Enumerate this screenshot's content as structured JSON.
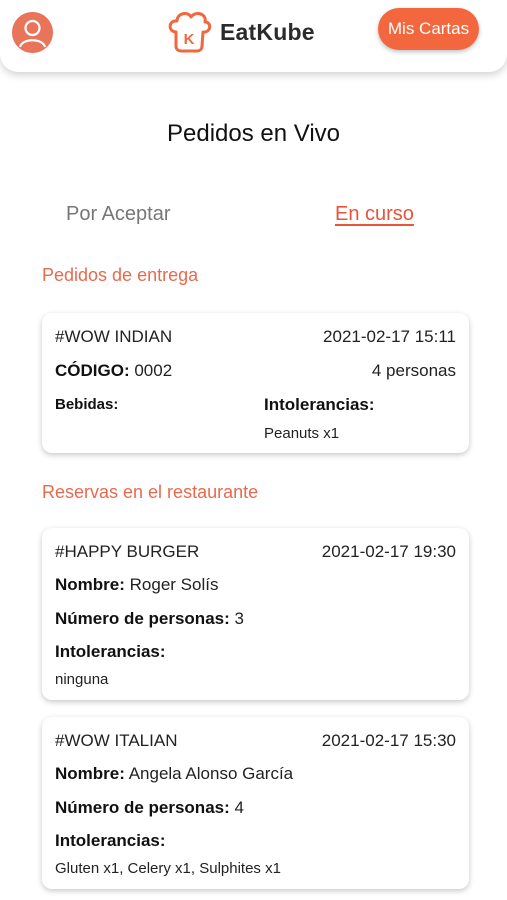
{
  "header": {
    "brand_name": "EatKube",
    "mis_cartas_label": "Mis Cartas",
    "avatar_icon": "user-avatar-icon",
    "logo_icon": "chef-hat-logo-icon",
    "accent_color": "#f2673d"
  },
  "page": {
    "title": "Pedidos en Vivo"
  },
  "tabs": {
    "pending_label": "Por Aceptar",
    "active_label": "En curso"
  },
  "delivery": {
    "section_title": "Pedidos de entrega",
    "orders": [
      {
        "restaurant": "#WOW INDIAN",
        "datetime": "2021-02-17 15:11",
        "code_label": "CÓDIGO:",
        "code_value": "0002",
        "people": "4 personas",
        "drinks_label": "Bebidas:",
        "intolerances_label": "Intolerancias:",
        "intolerances_value": "Peanuts x1"
      }
    ]
  },
  "reservations": {
    "section_title": "Reservas en el restaurante",
    "items": [
      {
        "restaurant": "#HAPPY BURGER",
        "datetime": "2021-02-17 19:30",
        "name_label": "Nombre:",
        "name_value": "Roger Solís",
        "people_label": "Número de personas:",
        "people_value": "3",
        "intolerances_label": "Intolerancias:",
        "intolerances_value": "ninguna"
      },
      {
        "restaurant": "#WOW ITALIAN",
        "datetime": "2021-02-17 15:30",
        "name_label": "Nombre:",
        "name_value": "Angela Alonso García",
        "people_label": "Número de personas:",
        "people_value": "4",
        "intolerances_label": "Intolerancias:",
        "intolerances_value": "Gluten x1, Celery x1, Sulphites x1"
      }
    ]
  }
}
